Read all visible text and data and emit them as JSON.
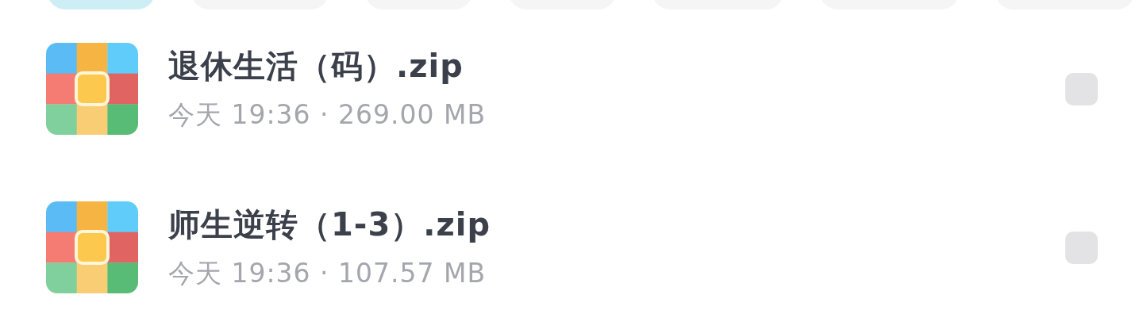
{
  "filter_tabs": [
    {
      "selected": true
    },
    {
      "selected": false
    },
    {
      "selected": false
    },
    {
      "selected": false
    },
    {
      "selected": false
    },
    {
      "selected": false
    },
    {
      "selected": false
    }
  ],
  "files": [
    {
      "kind": "archive",
      "name": "退休生活（码）.zip",
      "meta": "今天 19:36 · 269.00 MB",
      "checked": false
    },
    {
      "kind": "archive",
      "name": "师生逆转（1-3）.zip",
      "meta": "今天 19:36 · 107.57 MB",
      "checked": false
    }
  ]
}
